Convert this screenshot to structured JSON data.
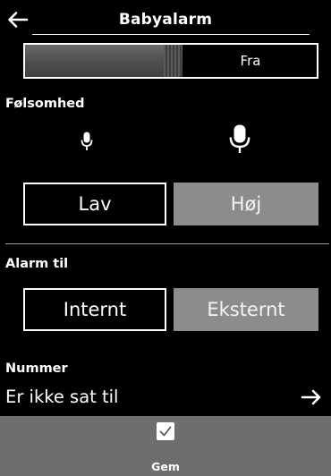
{
  "header": {
    "title": "Babyalarm"
  },
  "status_switch": {
    "label": "Fra",
    "state": "off"
  },
  "sensitivity": {
    "label": "Følsomhed",
    "options": [
      {
        "label": "Lav",
        "selected": false
      },
      {
        "label": "Høj",
        "selected": true
      }
    ]
  },
  "alarm_to": {
    "label": "Alarm til",
    "options": [
      {
        "label": "Internt",
        "selected": false
      },
      {
        "label": "Eksternt",
        "selected": true
      }
    ]
  },
  "number": {
    "label": "Nummer",
    "value": "Er ikke sat til"
  },
  "save": {
    "label": "Gem"
  },
  "colors": {
    "background": "#000000",
    "selected_button": "#8c8c8c",
    "save_bar": "#6e6e6e",
    "switch_knob": "#555555"
  }
}
